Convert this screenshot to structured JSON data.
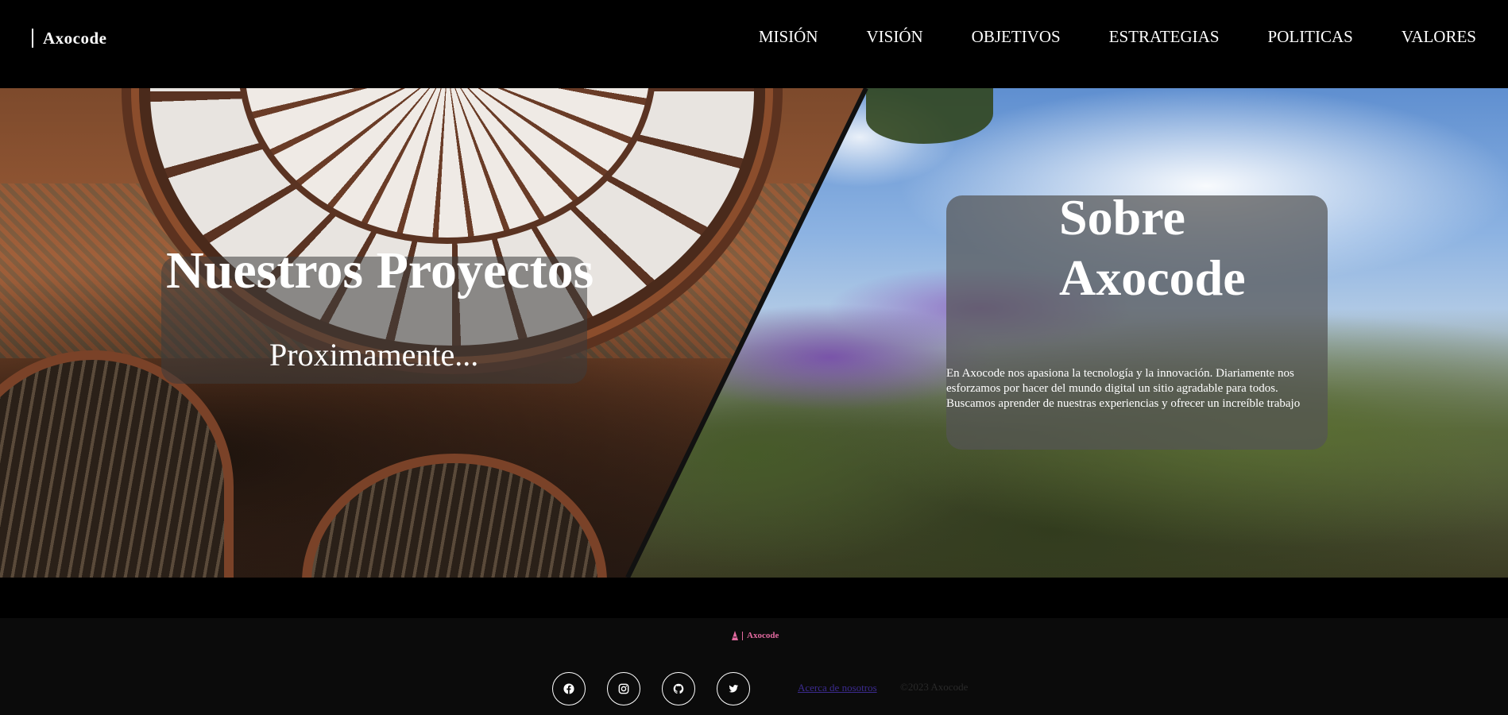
{
  "header": {
    "logo_text": "Axocode",
    "nav": [
      "MISIÓN",
      "VISIÓN",
      "OBJETIVOS",
      "ESTRATEGIAS",
      "POLITICAS",
      "VALORES"
    ]
  },
  "hero": {
    "projects": {
      "title": "Nuestros Proyectos",
      "subtitle": "Proximamente..."
    },
    "about": {
      "title_line1": "Sobre",
      "title_line2": "Axocode",
      "body": "En Axocode nos apasiona la tecnología y la innovación. Diariamente nos esforzamos por hacer del mundo digital un sitio agradable para todos. Buscamos aprender de nuestras experiencias y ofrecer un increíble trabajo"
    }
  },
  "footer": {
    "logo_text": "Axocode",
    "socials": [
      "facebook-icon",
      "instagram-icon",
      "github-icon",
      "twitter-icon"
    ],
    "about_link": "Acerca de nosotros",
    "copyright": "©2023 Axocode"
  },
  "colors": {
    "background": "#000000",
    "footer_bg": "#0b0b0b",
    "footer_logo": "#e36aa0",
    "footer_link": "#3c2b8f"
  }
}
